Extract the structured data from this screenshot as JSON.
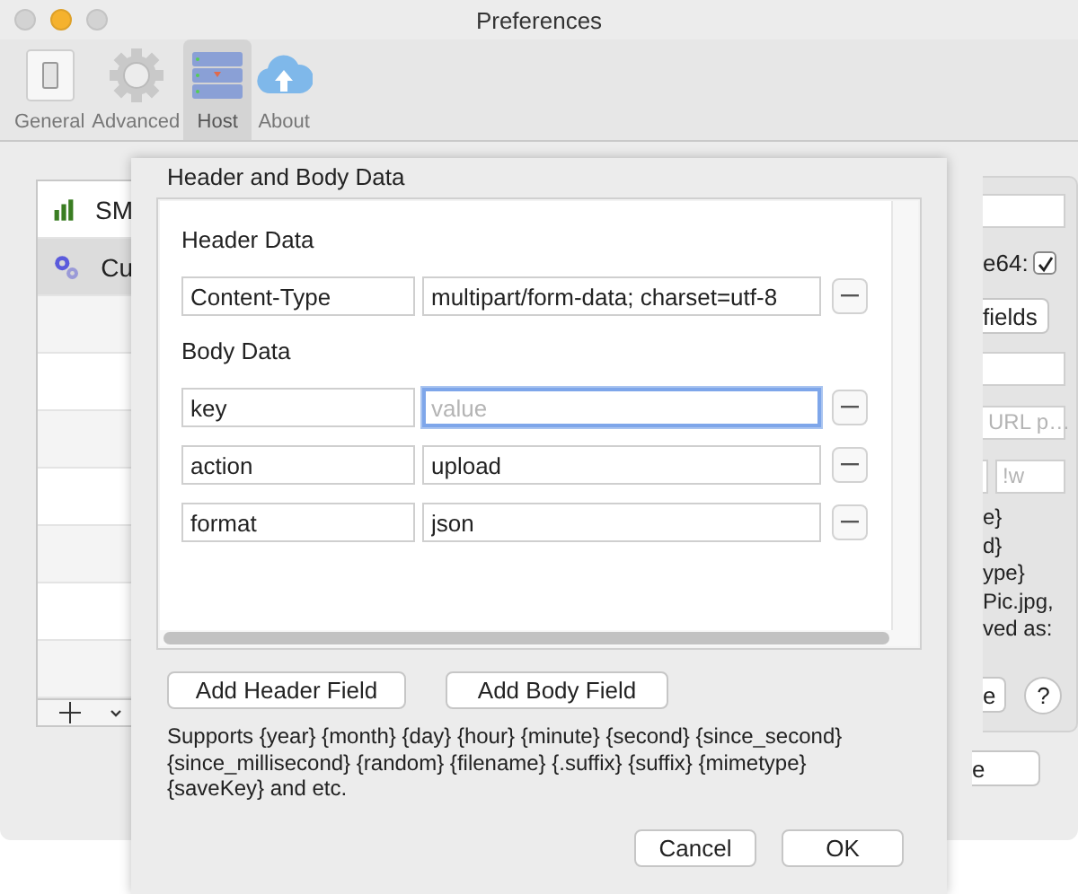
{
  "window": {
    "title": "Preferences"
  },
  "toolbar": [
    {
      "label": "General",
      "selected": false,
      "kind": "switch"
    },
    {
      "label": "Advanced",
      "selected": false,
      "kind": "gear"
    },
    {
      "label": "Host",
      "selected": true,
      "kind": "server"
    },
    {
      "label": "About",
      "selected": false,
      "kind": "cloud"
    }
  ],
  "host_list": {
    "items": [
      {
        "label": "SM",
        "selected": false,
        "kind": "bars"
      },
      {
        "label": "Cu",
        "selected": true,
        "kind": "gears"
      }
    ]
  },
  "host_settings": {
    "base64_label": "e64:",
    "base64_checked": true,
    "fields_button": "fields",
    "url_placeholder": "URL p…",
    "suffix_placeholder": "!w",
    "notes": [
      "e}",
      "d}",
      "ype}",
      "Pic.jpg,",
      "ved as:"
    ],
    "action_button": "e",
    "help_button": "?",
    "bottom_button": "e"
  },
  "sheet": {
    "title": "Header and Body Data",
    "header_title": "Header Data",
    "header_rows": [
      {
        "key": "Content-Type",
        "value": "multipart/form-data; charset=utf-8",
        "focused": false
      }
    ],
    "body_title": "Body Data",
    "body_rows": [
      {
        "key": "key",
        "placeholder": "value",
        "focused": true
      },
      {
        "key": "action",
        "value": "upload",
        "focused": false
      },
      {
        "key": "format",
        "value": "json",
        "focused": false
      }
    ],
    "add_header_button": "Add Header Field",
    "add_body_button": "Add Body Field",
    "help_text": "Supports {year} {month} {day} {hour} {minute} {second} {since_second} {since_millisecond} {random} {filename} {.suffix} {suffix} {mimetype} {saveKey} and etc.",
    "cancel_button": "Cancel",
    "ok_button": "OK"
  }
}
